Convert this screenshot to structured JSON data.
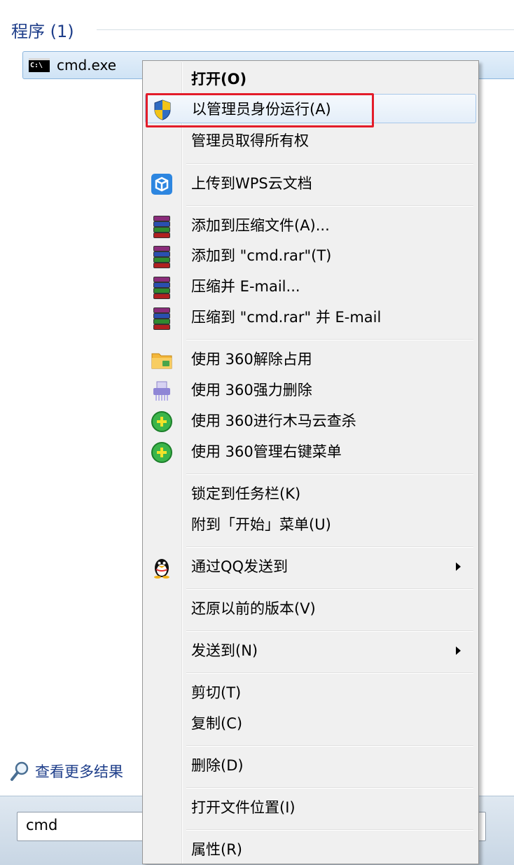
{
  "start_menu": {
    "section_title": "程序 (1)",
    "program_item": "cmd.exe",
    "program_icon_text": "C:\\",
    "see_more": "查看更多结果",
    "search_value": "cmd"
  },
  "context_menu": {
    "open": "打开(O)",
    "run_as_admin": "以管理员身份运行(A)",
    "take_ownership": "管理员取得所有权",
    "upload_wps": "上传到WPS云文档",
    "add_to_archive": "添加到压缩文件(A)...",
    "add_to_cmd_rar": "添加到 \"cmd.rar\"(T)",
    "compress_email": "压缩并 E-mail...",
    "compress_cmd_rar_email": "压缩到 \"cmd.rar\" 并 E-mail",
    "unlock_360": "使用 360解除占用",
    "force_delete_360": "使用 360强力删除",
    "trojan_scan_360": "使用 360进行木马云查杀",
    "manage_menu_360": "使用 360管理右键菜单",
    "pin_taskbar": "锁定到任务栏(K)",
    "pin_start": "附到「开始」菜单(U)",
    "send_qq": "通过QQ发送到",
    "restore_versions": "还原以前的版本(V)",
    "send_to": "发送到(N)",
    "cut": "剪切(T)",
    "copy": "复制(C)",
    "delete": "删除(D)",
    "open_location": "打开文件位置(I)",
    "properties": "属性(R)"
  },
  "colors": {
    "highlight_border": "#e31d2a",
    "menu_background": "#f0f0f0",
    "section_title": "#1e3e8a"
  },
  "icons": {
    "shield": "uac-shield-icon",
    "wps": "wps-cloud-icon",
    "winrar": "winrar-books-icon",
    "folder_360": "360-unlock-folder-icon",
    "shredder_360": "360-shredder-icon",
    "plus_360": "360-green-plus-icon",
    "qq": "qq-penguin-icon",
    "search": "search-magnifier-icon"
  }
}
